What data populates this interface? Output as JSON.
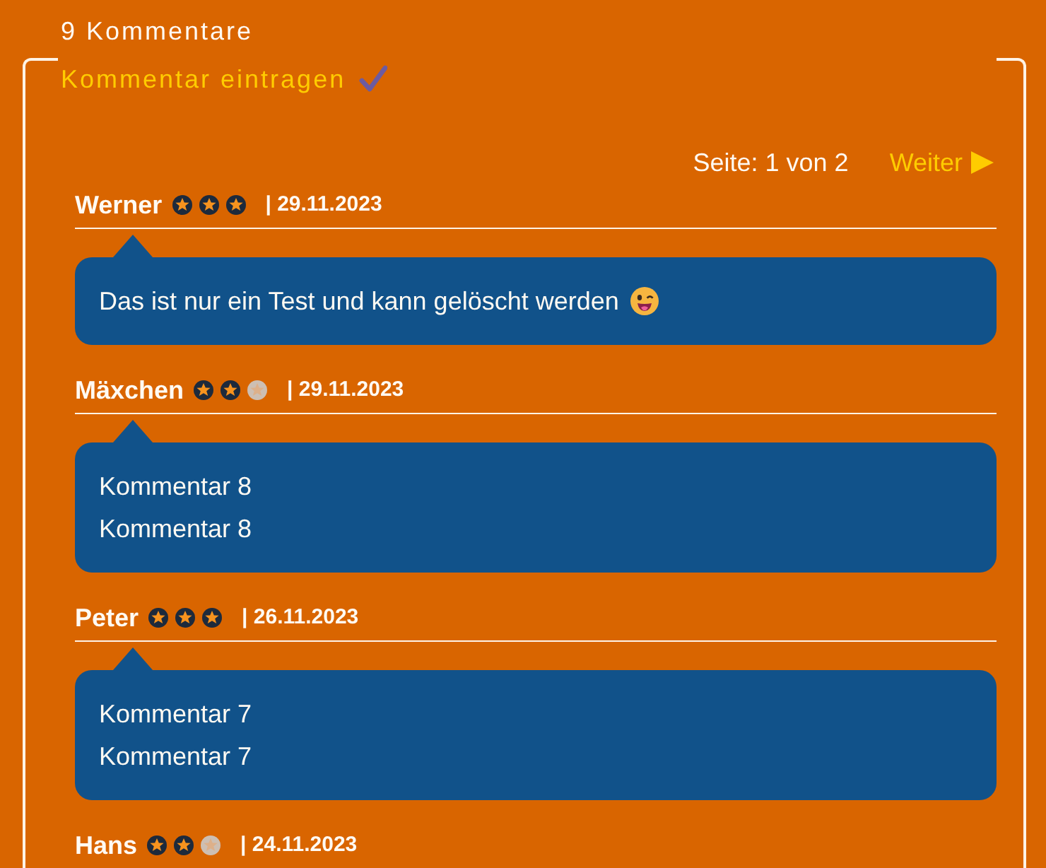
{
  "header": {
    "title": "9 Kommentare"
  },
  "write_link": {
    "label": "Kommentar eintragen"
  },
  "pagination": {
    "status": "Seite: 1 von 2",
    "next": "Weiter"
  },
  "comments": [
    {
      "author": "Werner",
      "stars": 3,
      "date": "| 29.11.2023",
      "lines": [
        "Das ist nur ein Test und kann gelöscht werden"
      ],
      "emoji": true
    },
    {
      "author": "Mäxchen",
      "stars": 2,
      "date": "| 29.11.2023",
      "lines": [
        "Kommentar 8",
        "Kommentar 8"
      ],
      "emoji": false
    },
    {
      "author": "Peter",
      "stars": 3,
      "date": "| 26.11.2023",
      "lines": [
        "Kommentar 7",
        "Kommentar 7"
      ],
      "emoji": false
    },
    {
      "author": "Hans",
      "stars": 2,
      "date": "| 24.11.2023"
    }
  ]
}
